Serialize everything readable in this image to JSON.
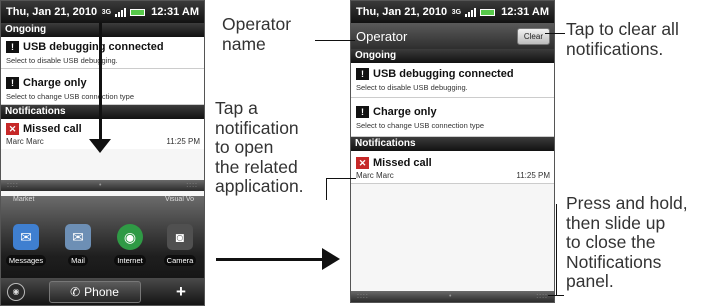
{
  "status_bar": {
    "date": "Thu, Jan 21, 2010",
    "network": "3G",
    "time": "12:31 AM"
  },
  "operator": {
    "name": "Operator",
    "clear_label": "Clear"
  },
  "sections": {
    "ongoing": "Ongoing",
    "notifications": "Notifications"
  },
  "notifications": {
    "usb": {
      "title": "USB debugging connected",
      "subtitle": "Select to disable USB debugging."
    },
    "charge": {
      "title": "Charge only",
      "subtitle": "Select to change USB connection type"
    },
    "missed": {
      "title": "Missed call",
      "caller": "Marc Marc",
      "time": "11:25 PM"
    }
  },
  "home": {
    "dock_labels": [
      "Market",
      "Visual Vo"
    ],
    "apps": [
      {
        "label": "Messages",
        "icon": "messages-icon",
        "color": "#3f7fd0"
      },
      {
        "label": "Mail",
        "icon": "mail-icon",
        "color": "#6d8fb5"
      },
      {
        "label": "Internet",
        "icon": "globe-icon",
        "color": "#2f9a45"
      },
      {
        "label": "Camera",
        "icon": "camera-icon",
        "color": "#505050"
      }
    ],
    "phone_label": "Phone",
    "plus_label": "+"
  },
  "callouts": {
    "operator_name": "Operator\nname",
    "tap_notification": "Tap a\nnotification\nto open\nthe related\napplication.",
    "tap_clear": "Tap to clear all\nnotifications.",
    "press_hold": "Press and hold,\nthen slide up\nto close the\nNotifications\npanel."
  }
}
